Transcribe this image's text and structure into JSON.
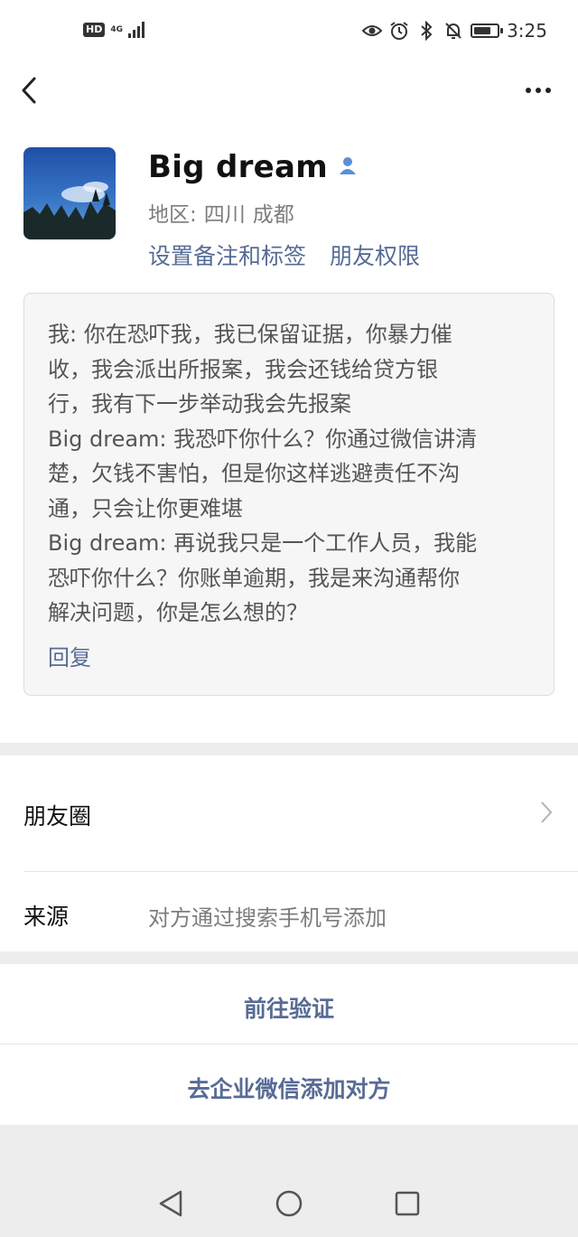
{
  "status_bar": {
    "hd": "HD",
    "network": "4G",
    "time": "3:25",
    "battery_level": 0.75
  },
  "profile": {
    "name": "Big dream",
    "region_label": "地区:",
    "region_province": "四川",
    "region_city": "成都",
    "set_remark_link": "设置备注和标签",
    "friend_permission_link": "朋友权限"
  },
  "message_card": {
    "lines": [
      "我: 你在恐吓我，我已保留证据，你暴力催",
      "收，我会派出所报案，我会还钱给贷方银",
      "行，我有下一步举动我会先报案",
      "Big dream: 我恐吓你什么？你通过微信讲清",
      "楚，欠钱不害怕，但是你这样逃避责任不沟",
      "通，只会让你更难堪",
      "Big dream: 再说我只是一个工作人员，我能",
      "恐吓你什么？你账单逾期，我是来沟通帮你",
      "解决问题，你是怎么想的？"
    ],
    "reply": "回复"
  },
  "moments": {
    "label": "朋友圈"
  },
  "source": {
    "label": "来源",
    "value": "对方通过搜索手机号添加"
  },
  "actions": {
    "verify": "前往验证",
    "enterprise": "去企业微信添加对方"
  },
  "colors": {
    "link": "#576b95",
    "separator": "#ededed",
    "card_bg": "#f6f6f6"
  }
}
